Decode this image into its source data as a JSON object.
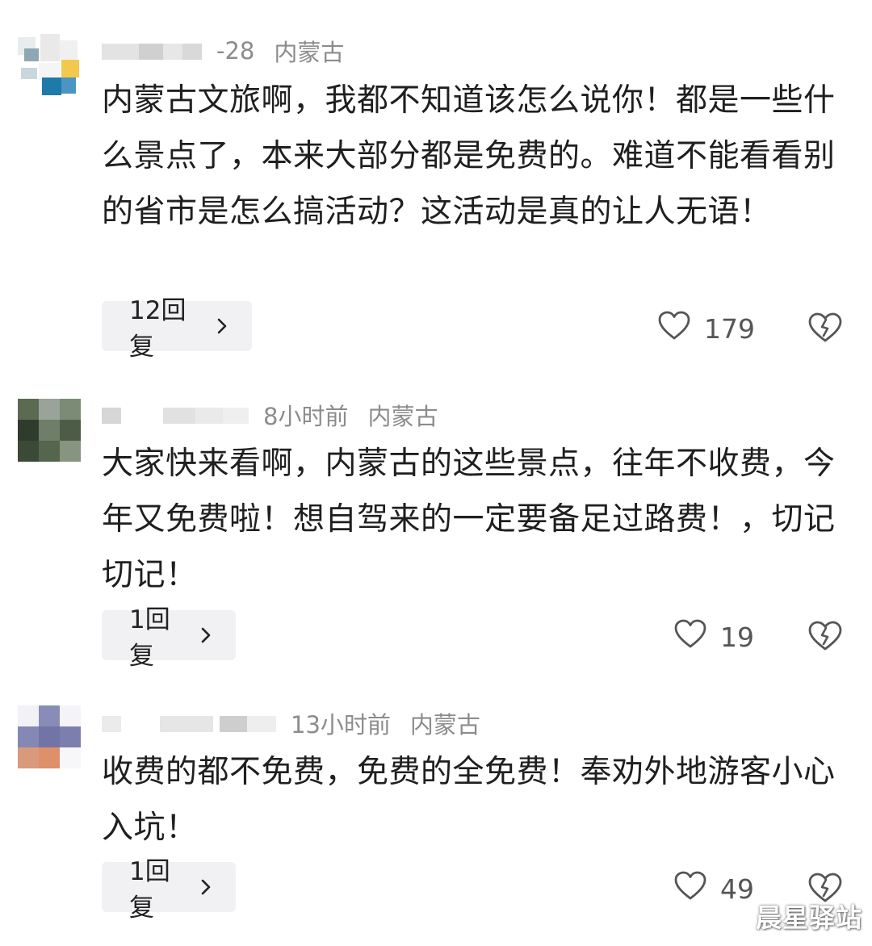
{
  "comments": [
    {
      "time": "-28",
      "location": "内蒙古",
      "text": "内蒙古文旅啊，我都不知道该怎么说你！都是一些什么景点了，本来大部分都是免费的。难道不能看看别的省市是怎么搞活动？这活动是真的让人无语！",
      "reply_label": "12回复",
      "likes": "179",
      "avatar_icon": "avatar-pixelated"
    },
    {
      "time": "8小时前",
      "location": "内蒙古",
      "text": "大家快来看啊，内蒙古的这些景点，往年不收费，今年又免费啦！想自驾来的一定要备足过路费！，切记切记！",
      "reply_label": "1回复",
      "likes": "19",
      "avatar_icon": "avatar-pixelated"
    },
    {
      "time": "13小时前",
      "location": "内蒙古",
      "text": "收费的都不免费，免费的全免费！奉劝外地游客小心入坑！",
      "reply_label": "1回复",
      "likes": "49",
      "avatar_icon": "avatar-pixelated"
    }
  ],
  "icons": {
    "like": "heart-outline-icon",
    "dislike": "broken-heart-icon",
    "reply_arrow": "chevron-right-icon"
  },
  "watermark": "晨星驿站",
  "colors": {
    "text": "#1f1f1f",
    "meta": "#8c8c8c",
    "reply_bg": "#f1f1f3",
    "icon": "#555555"
  }
}
